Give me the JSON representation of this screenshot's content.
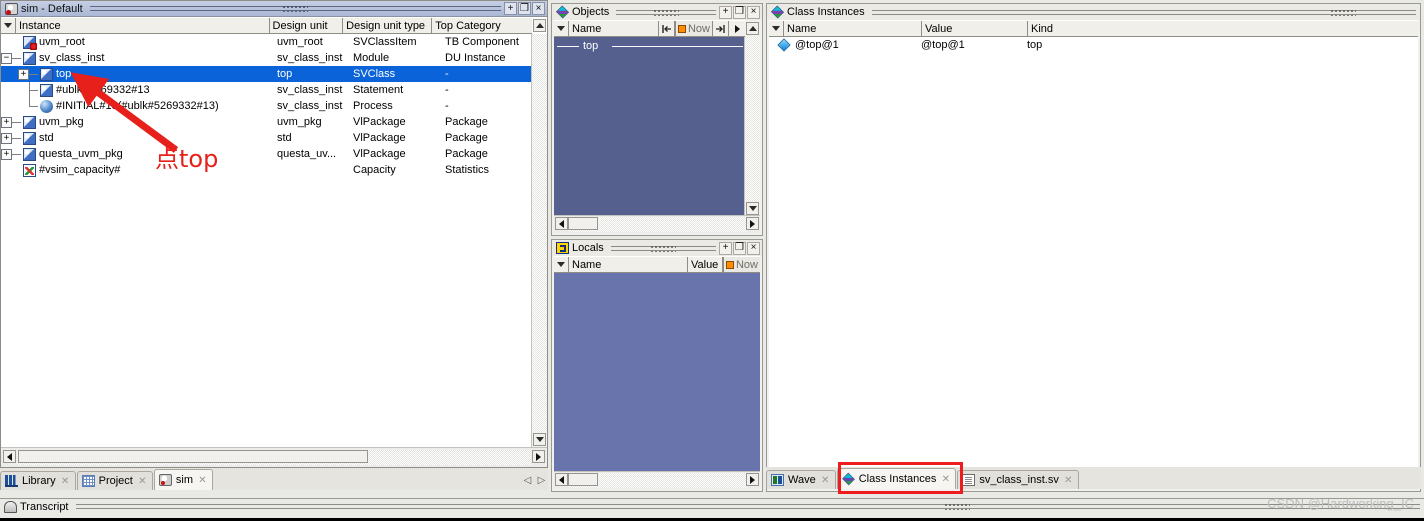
{
  "sim_panel": {
    "title": "sim - Default",
    "title_icon": "simulation-icon",
    "buttons": {
      "dock": "+",
      "undock": "❐",
      "close": "×"
    },
    "columns": [
      "Instance",
      "Design unit",
      "Design unit type",
      "Top Category"
    ],
    "rows": [
      {
        "name": "uvm_root",
        "design_unit": "uvm_root",
        "design_unit_type": "SVClassItem",
        "top_category": "TB Component",
        "icon": "uvm-root-icon",
        "indent": 1,
        "expander": "none",
        "selected": false
      },
      {
        "name": "sv_class_inst",
        "design_unit": "sv_class_inst",
        "design_unit_type": "Module",
        "top_category": "DU Instance",
        "icon": "module-icon",
        "indent": 0,
        "expander": "minus",
        "selected": false
      },
      {
        "name": "top",
        "design_unit": "top",
        "design_unit_type": "SVClass",
        "top_category": "-",
        "icon": "module-icon",
        "indent": 1,
        "expander": "plus",
        "selected": true
      },
      {
        "name": "#ublk#5269332#13",
        "design_unit": "sv_class_inst",
        "design_unit_type": "Statement",
        "top_category": "-",
        "icon": "module-icon",
        "indent": 1,
        "expander": "none",
        "selected": false
      },
      {
        "name": "#INITIAL#13(#ublk#5269332#13)",
        "design_unit": "sv_class_inst",
        "design_unit_type": "Process",
        "top_category": "-",
        "icon": "process-icon",
        "indent": 1,
        "expander": "none",
        "selected": false
      },
      {
        "name": "uvm_pkg",
        "design_unit": "uvm_pkg",
        "design_unit_type": "VlPackage",
        "top_category": "Package",
        "icon": "module-icon",
        "indent": 0,
        "expander": "plus",
        "selected": false
      },
      {
        "name": "std",
        "design_unit": "std",
        "design_unit_type": "VlPackage",
        "top_category": "Package",
        "icon": "module-icon",
        "indent": 0,
        "expander": "plus",
        "selected": false
      },
      {
        "name": "questa_uvm_pkg",
        "design_unit": "questa_uv...",
        "design_unit_type": "VlPackage",
        "top_category": "Package",
        "icon": "module-icon",
        "indent": 0,
        "expander": "plus",
        "selected": false
      },
      {
        "name": "#vsim_capacity#",
        "design_unit": "",
        "design_unit_type": "Capacity",
        "top_category": "Statistics",
        "icon": "capacity-icon",
        "indent": 0,
        "expander": "none",
        "selected": false
      }
    ]
  },
  "objects_panel": {
    "title": "Objects",
    "title_icon": "objects-icon",
    "buttons": {
      "dock": "+",
      "undock": "❐",
      "close": "×"
    },
    "columns": [
      "Name"
    ],
    "now_label": "Now",
    "group_label": "top"
  },
  "locals_panel": {
    "title": "Locals",
    "title_icon": "locals-icon",
    "buttons": {
      "dock": "+",
      "undock": "❐",
      "close": "×"
    },
    "columns": [
      "Name",
      "Value"
    ],
    "now_label": "Now"
  },
  "class_instances_panel": {
    "title": "Class Instances",
    "title_icon": "class-instances-icon",
    "columns": [
      "Name",
      "Value",
      "Kind"
    ],
    "rows": [
      {
        "name": "@top@1",
        "value": "@top@1",
        "kind": "top",
        "icon": "class-instance-diamond-icon"
      }
    ]
  },
  "left_tabs": [
    {
      "label": "Library",
      "icon": "library-icon",
      "active": false,
      "closable": true
    },
    {
      "label": "Project",
      "icon": "project-icon",
      "active": false,
      "closable": true
    },
    {
      "label": "sim",
      "icon": "sim-icon",
      "active": true,
      "closable": true
    }
  ],
  "left_tabs_nav": {
    "prev": "◁",
    "next": "▷"
  },
  "right_tabs": [
    {
      "label": "Wave",
      "icon": "wave-icon",
      "active": false,
      "closable": true
    },
    {
      "label": "Class Instances",
      "icon": "class-instances-icon",
      "active": true,
      "closable": true
    },
    {
      "label": "sv_class_inst.sv",
      "icon": "source-file-icon",
      "active": false,
      "closable": true
    }
  ],
  "transcript_panel": {
    "title": "Transcript",
    "title_icon": "transcript-icon"
  },
  "annotations": {
    "callout_text": "点top",
    "callout_color": "#e8201b",
    "arrow_color": "#e8201b",
    "highlight_box_color": "#ee1c1c",
    "watermark": "CSDN @Hardworking_IC"
  },
  "colors": {
    "selection_blue": "#0a63d8",
    "objects_bg": "#55608e",
    "locals_bg": "#6a74ac",
    "titlebar_blue": "#aab7d4",
    "now_orange": "#ff8c00"
  }
}
